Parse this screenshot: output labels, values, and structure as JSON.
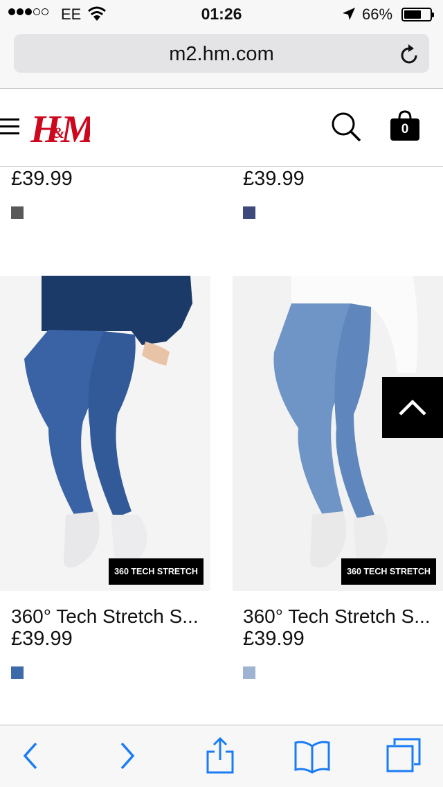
{
  "status_bar": {
    "carrier": "EE",
    "time": "01:26",
    "battery": "66%",
    "signal_bars_filled": 3,
    "signal_bars_total": 5
  },
  "browser": {
    "url": "m2.hm.com",
    "reload_icon": "reload-icon"
  },
  "site": {
    "logo_text": "H&M",
    "brand_color": "#cc071e",
    "bag_count": "0"
  },
  "products_top": [
    {
      "price": "£39.99",
      "swatch_color": "#595959"
    },
    {
      "price": "£39.99",
      "swatch_color": "#3c4a7c"
    }
  ],
  "products": [
    {
      "name": "360° Tech Stretch S...",
      "price": "£39.99",
      "badge": "360 TECH STRETCH",
      "swatch_color": "#3d6aa8",
      "denim": "#3a63a6"
    },
    {
      "name": "360° Tech Stretch S...",
      "price": "£39.99",
      "badge": "360 TECH STRETCH",
      "swatch_color": "#9db4d2",
      "denim": "#6f95c6"
    }
  ],
  "toolbar": {
    "accent": "#1a7cf5",
    "icons": [
      "back-icon",
      "forward-icon",
      "share-icon",
      "bookmarks-icon",
      "tabs-icon"
    ]
  }
}
